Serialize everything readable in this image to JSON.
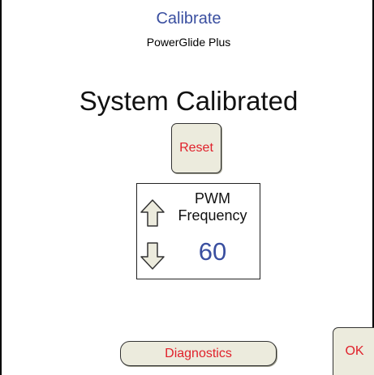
{
  "header": {
    "title": "Calibrate",
    "subtitle": "PowerGlide Plus"
  },
  "status": {
    "text": "System Calibrated"
  },
  "reset_button": {
    "label": "Reset"
  },
  "pwm": {
    "label_line1": "PWM",
    "label_line2": "Frequency",
    "value": "60",
    "up_icon": "arrow-up-icon",
    "down_icon": "arrow-down-icon"
  },
  "footer": {
    "diagnostics_label": "Diagnostics",
    "ok_label": "OK"
  },
  "colors": {
    "title": "#3a4fa0",
    "button_text": "#e0202a",
    "button_bg": "#ecebdd",
    "value": "#3a4fa0"
  }
}
